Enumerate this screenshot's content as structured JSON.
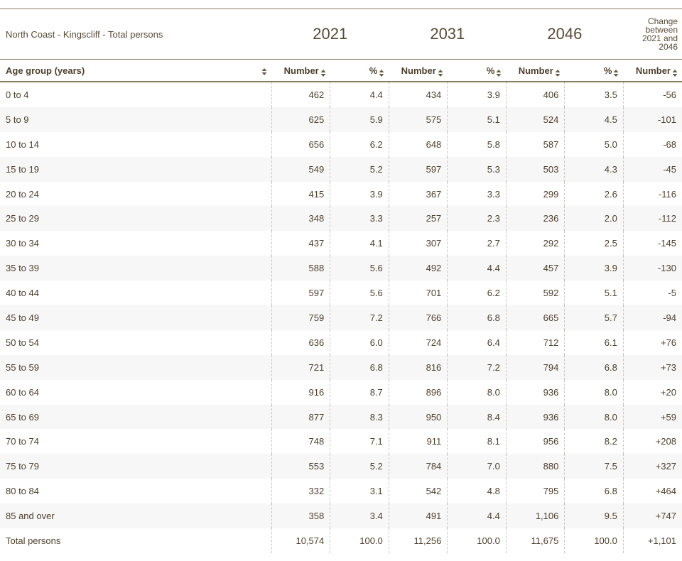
{
  "table": {
    "title": "North Coast - Kingscliff - Total persons",
    "years": [
      "2021",
      "2031",
      "2046"
    ],
    "change_header": [
      "Change",
      "between",
      "2021 and",
      "2046"
    ],
    "subheaders": {
      "age": "Age group (years)",
      "number": "Number",
      "percent": "%",
      "change_number": "Number"
    },
    "rows": [
      [
        "0 to 4",
        "462",
        "4.4",
        "434",
        "3.9",
        "406",
        "3.5",
        "-56"
      ],
      [
        "5 to 9",
        "625",
        "5.9",
        "575",
        "5.1",
        "524",
        "4.5",
        "-101"
      ],
      [
        "10 to 14",
        "656",
        "6.2",
        "648",
        "5.8",
        "587",
        "5.0",
        "-68"
      ],
      [
        "15 to 19",
        "549",
        "5.2",
        "597",
        "5.3",
        "503",
        "4.3",
        "-45"
      ],
      [
        "20 to 24",
        "415",
        "3.9",
        "367",
        "3.3",
        "299",
        "2.6",
        "-116"
      ],
      [
        "25 to 29",
        "348",
        "3.3",
        "257",
        "2.3",
        "236",
        "2.0",
        "-112"
      ],
      [
        "30 to 34",
        "437",
        "4.1",
        "307",
        "2.7",
        "292",
        "2.5",
        "-145"
      ],
      [
        "35 to 39",
        "588",
        "5.6",
        "492",
        "4.4",
        "457",
        "3.9",
        "-130"
      ],
      [
        "40 to 44",
        "597",
        "5.6",
        "701",
        "6.2",
        "592",
        "5.1",
        "-5"
      ],
      [
        "45 to 49",
        "759",
        "7.2",
        "766",
        "6.8",
        "665",
        "5.7",
        "-94"
      ],
      [
        "50 to 54",
        "636",
        "6.0",
        "724",
        "6.4",
        "712",
        "6.1",
        "+76"
      ],
      [
        "55 to 59",
        "721",
        "6.8",
        "816",
        "7.2",
        "794",
        "6.8",
        "+73"
      ],
      [
        "60 to 64",
        "916",
        "8.7",
        "896",
        "8.0",
        "936",
        "8.0",
        "+20"
      ],
      [
        "65 to 69",
        "877",
        "8.3",
        "950",
        "8.4",
        "936",
        "8.0",
        "+59"
      ],
      [
        "70 to 74",
        "748",
        "7.1",
        "911",
        "8.1",
        "956",
        "8.2",
        "+208"
      ],
      [
        "75 to 79",
        "553",
        "5.2",
        "784",
        "7.0",
        "880",
        "7.5",
        "+327"
      ],
      [
        "80 to 84",
        "332",
        "3.1",
        "542",
        "4.8",
        "795",
        "6.8",
        "+464"
      ],
      [
        "85 and over",
        "358",
        "3.4",
        "491",
        "4.4",
        "1,106",
        "9.5",
        "+747"
      ],
      [
        "Total persons",
        "10,574",
        "100.0",
        "11,256",
        "100.0",
        "11,675",
        "100.0",
        "+1,101"
      ]
    ]
  },
  "colors": {
    "text": "#5a4a35",
    "rule": "#8a7a62",
    "stripe": "#f7f7f7",
    "sort_icon": "#6b5a40"
  },
  "icons": {
    "sort": "sort-icon"
  }
}
